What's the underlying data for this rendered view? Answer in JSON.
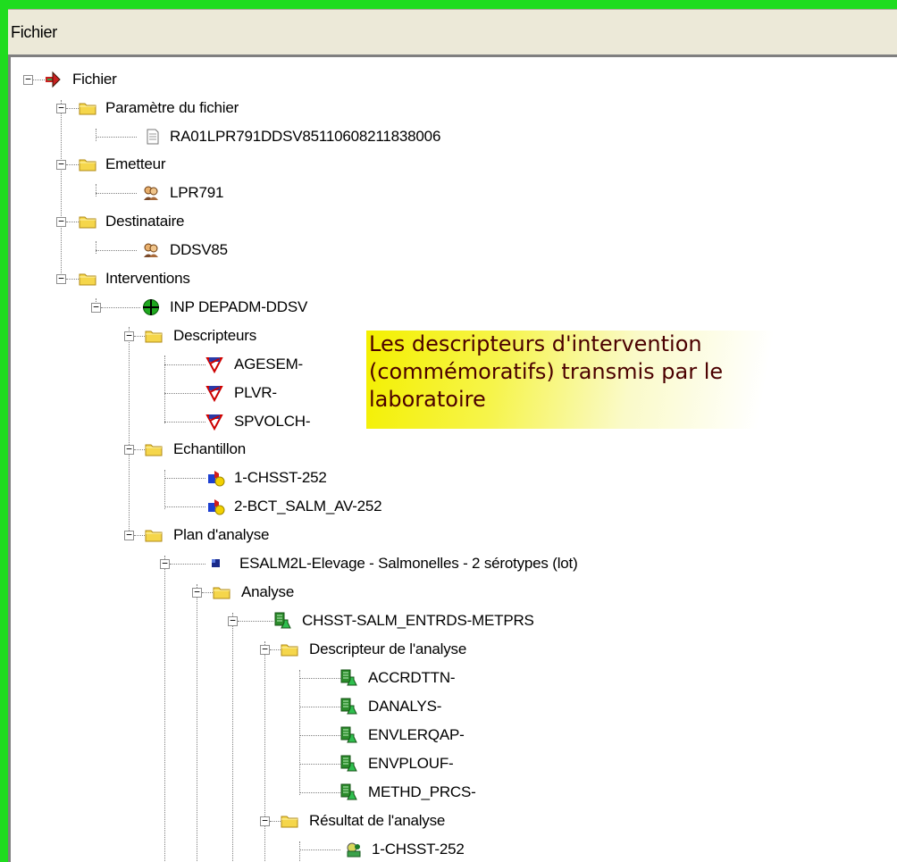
{
  "header": {
    "title": "Fichier"
  },
  "tree": {
    "root": "Fichier",
    "parametre_folder": "Paramètre du fichier",
    "parametre_file": "RA01LPR791DDSV85110608211838006",
    "emetteur_folder": "Emetteur",
    "emetteur_value": "LPR791",
    "destinataire_folder": "Destinataire",
    "destinataire_value": "DDSV85",
    "interventions_folder": "Interventions",
    "intervention": "INP DEPADM-DDSV",
    "descripteurs_folder": "Descripteurs",
    "descripteurs": [
      "AGESEM-",
      "PLVR-",
      "SPVOLCH-"
    ],
    "echantillon_folder": "Echantillon",
    "echantillons": [
      "1-CHSST-252",
      "2-BCT_SALM_AV-252"
    ],
    "plan_folder": "Plan d'analyse",
    "plan_item": "ESALM2L-Elevage - Salmonelles - 2 sérotypes (lot)",
    "analyse_folder": "Analyse",
    "analyse_item": "CHSST-SALM_ENTRDS-METPRS",
    "descripteur_analyse_folder": "Descripteur de l'analyse",
    "descripteurs_analyse": [
      "ACCRDTTN-",
      "DANALYS-",
      "ENVLERQAP-",
      "ENVPLOUF-",
      "METHD_PRCS-"
    ],
    "resultat_folder": "Résultat de l'analyse",
    "resultat_item": "1-CHSST-252"
  },
  "callout": {
    "lines": [
      "Les descripteurs d'intervention",
      "(commémoratifs) transmis par le",
      "laboratoire"
    ]
  },
  "colors": {
    "frame": "#1fdc1f",
    "callout": "#f4f000"
  },
  "icons": {
    "root": "red-arrow-icon",
    "folder": "folder-icon",
    "file": "document-icon",
    "person": "people-icon",
    "intervention": "green-crosshair-icon",
    "descriptor": "descriptor-badge-icon",
    "sample": "sample-shapes-icon",
    "plan": "blue-square-icon",
    "analysis": "flask-icon",
    "result": "result-icon"
  }
}
